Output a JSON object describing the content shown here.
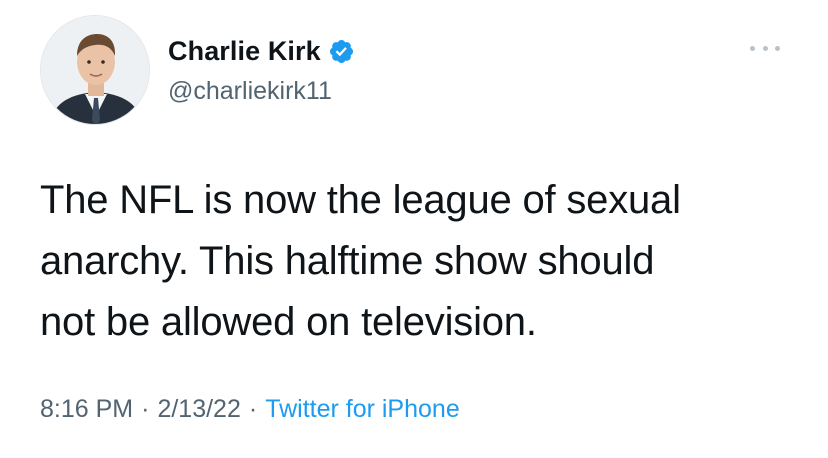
{
  "tweet": {
    "author": {
      "display_name": "Charlie Kirk",
      "handle": "@charliekirk11",
      "verified": true,
      "avatar_icon": "profile-photo"
    },
    "text_lines": [
      "The NFL is now the league of sexual",
      "anarchy. This halftime show should",
      "not be allowed on television."
    ],
    "time": "8:16 PM",
    "date": "2/13/22",
    "separator": "·",
    "source": "Twitter for iPhone",
    "more_icon": "more-options-icon"
  },
  "colors": {
    "verified_badge": "#1d9bf0",
    "link": "#1d9bf0",
    "secondary_text": "#536471",
    "primary_text": "#0f1419"
  }
}
